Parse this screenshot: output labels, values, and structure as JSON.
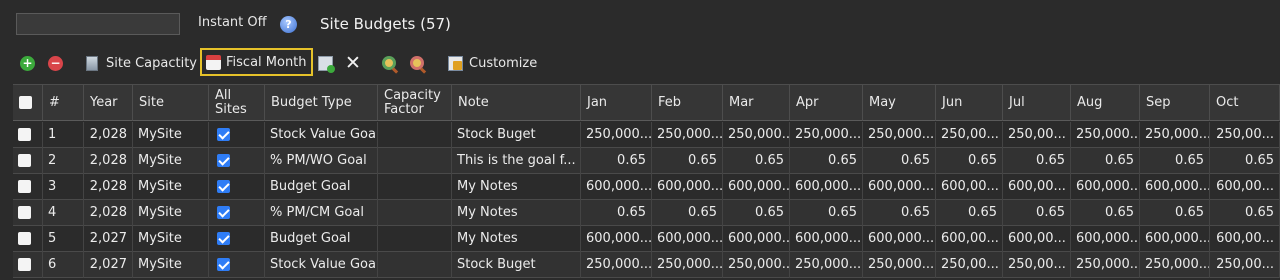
{
  "topbar": {
    "search_value": "",
    "instant_label": "Instant Off",
    "help_icon": "help-icon",
    "title": "Site Budgets (57)"
  },
  "toolbar": {
    "add_icon": "add-icon",
    "remove_icon": "remove-icon",
    "site_capacity_label": "Site Capactity",
    "fiscal_month_label": "Fiscal Month",
    "customize_label": "Customize"
  },
  "columns": [
    "#",
    "Year",
    "Site",
    "All Sites",
    "Budget Type",
    "Capacity Factor",
    "Note",
    "Jan",
    "Feb",
    "Mar",
    "Apr",
    "May",
    "Jun",
    "Jul",
    "Aug",
    "Sep",
    "Oct"
  ],
  "rows": [
    {
      "n": "1",
      "year": "2,028",
      "site": "MySite",
      "all_sites": true,
      "budget_type": "Stock Value Goal",
      "note": "Stock Buget",
      "months": [
        "250,000....",
        "250,000...",
        "250,000...",
        "250,000...",
        "250,000....",
        "250,00...",
        "250,00...",
        "250,000...",
        "250,000...",
        "250,00..."
      ]
    },
    {
      "n": "2",
      "year": "2,028",
      "site": "MySite",
      "all_sites": true,
      "budget_type": "% PM/WO Goal",
      "note": "This is the goal f...",
      "months": [
        "0.65",
        "0.65",
        "0.65",
        "0.65",
        "0.65",
        "0.65",
        "0.65",
        "0.65",
        "0.65",
        "0.65"
      ]
    },
    {
      "n": "3",
      "year": "2,028",
      "site": "MySite",
      "all_sites": true,
      "budget_type": "Budget Goal",
      "note": "My Notes",
      "months": [
        "600,000....",
        "600,000...",
        "600,000...",
        "600,000...",
        "600,000....",
        "600,00...",
        "600,00...",
        "600,000...",
        "600,000...",
        "600,00..."
      ]
    },
    {
      "n": "4",
      "year": "2,028",
      "site": "MySite",
      "all_sites": true,
      "budget_type": "% PM/CM Goal",
      "note": "My Notes",
      "months": [
        "0.65",
        "0.65",
        "0.65",
        "0.65",
        "0.65",
        "0.65",
        "0.65",
        "0.65",
        "0.65",
        "0.65"
      ]
    },
    {
      "n": "5",
      "year": "2,027",
      "site": "MySite",
      "all_sites": true,
      "budget_type": "Budget Goal",
      "note": "My Notes",
      "months": [
        "600,000....",
        "600,000...",
        "600,000...",
        "600,000...",
        "600,000....",
        "600,00...",
        "600,00...",
        "600,000...",
        "600,000...",
        "600,00..."
      ]
    },
    {
      "n": "6",
      "year": "2,027",
      "site": "MySite",
      "all_sites": true,
      "budget_type": "Stock Value Goal",
      "note": "Stock Buget",
      "months": [
        "250,000....",
        "250,000...",
        "250,000...",
        "250,000...",
        "250,000....",
        "250,00...",
        "250,00...",
        "250,000...",
        "250,000...",
        "250,00..."
      ]
    }
  ]
}
